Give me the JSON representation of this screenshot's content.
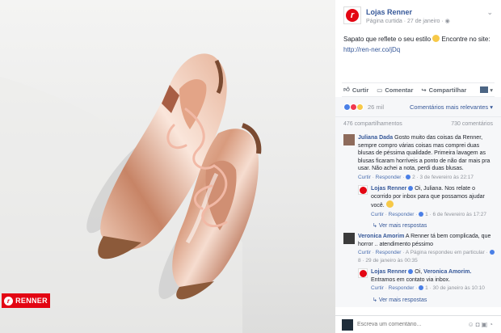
{
  "photo": {
    "brand_label": "RENNER"
  },
  "post": {
    "page_name": "Lojas Renner",
    "meta": "Página curtida · 27 de janeiro · ",
    "text": "Sapato que reflete o seu estilo",
    "text2": " Encontre no site: ",
    "link": "http://ren-ner.co/jDq"
  },
  "actions": {
    "like": "Curtir",
    "comment": "Comentar",
    "share": "Compartilhar"
  },
  "reactions": {
    "count": "26 mil",
    "sort_label": "Comentários mais relevantes"
  },
  "counts": {
    "shares": "476 compartilhamentos",
    "comments": "730 comentários"
  },
  "comments": [
    {
      "author": "Juliana Dada",
      "text": "Gosto muito das coisas da Renner, sempre compro várias coisas mas comprei duas blusas de péssima qualidade. Primeira lavagem as blusas ficaram horríveis a ponto de não dar mais pra usar. Não achei a nota, perdi duas blusas.",
      "like": "Curtir",
      "reply": "Responder",
      "reactions": "2",
      "time": "3 de fevereiro às 22:17"
    },
    {
      "author": "Veronica Amorim",
      "text": "A Renner tá bem complicada, que horror .. atendimento péssimo",
      "like": "Curtir",
      "reply": "Responder",
      "answered": "A Página respondeu em particular",
      "reactions": "8",
      "time": "29 de janeiro às 00:35"
    }
  ],
  "replies": [
    {
      "author": "Lojas Renner",
      "text": "Oi, Juliana. Nos relate o ocorrido por inbox para que possamos ajudar você.",
      "like": "Curtir",
      "reply": "Responder",
      "reactions": "1",
      "time": "6 de fevereiro às 17:27"
    },
    {
      "author": "Lojas Renner",
      "mention": "Veronica Amorim.",
      "text": " Entramos em contato via inbox.",
      "greeting": "Oi, ",
      "like": "Curtir",
      "reply": "Responder",
      "reactions": "1",
      "time": "30 de janeiro às 10:10"
    }
  ],
  "more_replies": "Ver mais respostas",
  "comment_box": {
    "placeholder": "Escreva um comentário..."
  },
  "colors": {
    "brand_red": "#e30613",
    "fb_blue": "#365899"
  }
}
